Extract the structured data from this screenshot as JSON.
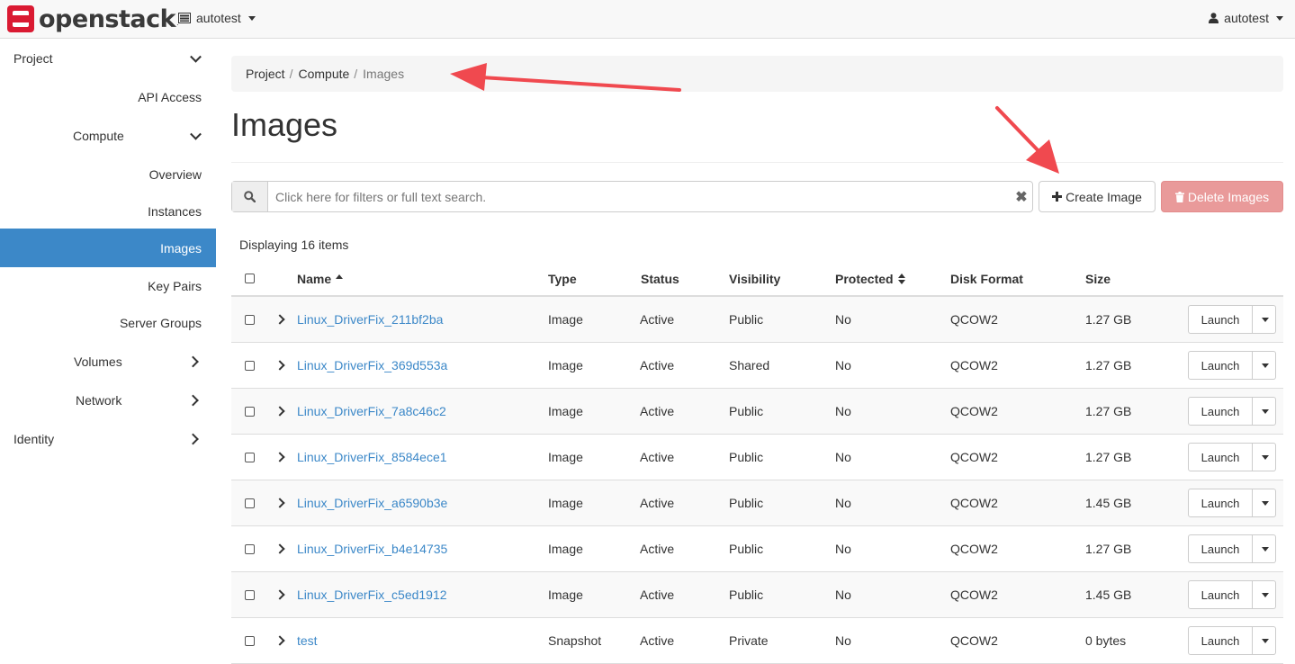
{
  "brand": {
    "name": "openstack",
    "tm": "."
  },
  "header": {
    "project": "autotest",
    "user": "autotest"
  },
  "sidebar": {
    "items": [
      {
        "label": "Project",
        "chevron": "down"
      },
      {
        "label": "API Access"
      },
      {
        "label": "Compute",
        "chevron": "down"
      },
      {
        "label": "Overview"
      },
      {
        "label": "Instances"
      },
      {
        "label": "Images",
        "active": true
      },
      {
        "label": "Key Pairs"
      },
      {
        "label": "Server Groups"
      },
      {
        "label": "Volumes",
        "chevron": "right"
      },
      {
        "label": "Network",
        "chevron": "right"
      },
      {
        "label": "Identity",
        "chevron": "right"
      }
    ]
  },
  "breadcrumb": {
    "items": [
      "Project",
      "Compute"
    ],
    "current": "Images",
    "separator": "/"
  },
  "page": {
    "title": "Images"
  },
  "filter": {
    "placeholder": "Click here for filters or full text search.",
    "clear": "✖"
  },
  "actions": {
    "create_label": "Create Image",
    "delete_label": "Delete Images"
  },
  "table": {
    "count_label": "Displaying 16 items",
    "headers": [
      "Name",
      "Type",
      "Status",
      "Visibility",
      "Protected",
      "Disk Format",
      "Size"
    ],
    "rows": [
      {
        "name": "Linux_DriverFix_211bf2ba",
        "type": "Image",
        "status": "Active",
        "visibility": "Public",
        "protected": "No",
        "format": "QCOW2",
        "size": "1.27 GB"
      },
      {
        "name": "Linux_DriverFix_369d553a",
        "type": "Image",
        "status": "Active",
        "visibility": "Shared",
        "protected": "No",
        "format": "QCOW2",
        "size": "1.27 GB"
      },
      {
        "name": "Linux_DriverFix_7a8c46c2",
        "type": "Image",
        "status": "Active",
        "visibility": "Public",
        "protected": "No",
        "format": "QCOW2",
        "size": "1.27 GB"
      },
      {
        "name": "Linux_DriverFix_8584ece1",
        "type": "Image",
        "status": "Active",
        "visibility": "Public",
        "protected": "No",
        "format": "QCOW2",
        "size": "1.27 GB"
      },
      {
        "name": "Linux_DriverFix_a6590b3e",
        "type": "Image",
        "status": "Active",
        "visibility": "Public",
        "protected": "No",
        "format": "QCOW2",
        "size": "1.45 GB"
      },
      {
        "name": "Linux_DriverFix_b4e14735",
        "type": "Image",
        "status": "Active",
        "visibility": "Public",
        "protected": "No",
        "format": "QCOW2",
        "size": "1.27 GB"
      },
      {
        "name": "Linux_DriverFix_c5ed1912",
        "type": "Image",
        "status": "Active",
        "visibility": "Public",
        "protected": "No",
        "format": "QCOW2",
        "size": "1.45 GB"
      },
      {
        "name": "test",
        "type": "Snapshot",
        "status": "Active",
        "visibility": "Private",
        "protected": "No",
        "format": "QCOW2",
        "size": "0 bytes"
      }
    ],
    "launch_label": "Launch"
  },
  "colors": {
    "accent": "#3c88c8",
    "danger": "#e99a9a",
    "annotation": "#f0494f"
  }
}
